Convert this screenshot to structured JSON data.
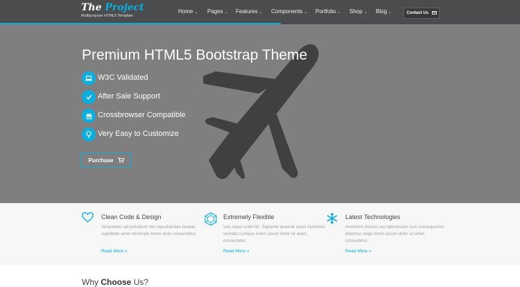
{
  "brand": {
    "title_part1": "The",
    "title_part2": "Project",
    "tagline": "Multipurpose HTML5 Template"
  },
  "nav": {
    "items": [
      {
        "label": "Home"
      },
      {
        "label": "Pages"
      },
      {
        "label": "Features"
      },
      {
        "label": "Components"
      },
      {
        "label": "Portfolio"
      },
      {
        "label": "Shop"
      },
      {
        "label": "Blog"
      }
    ],
    "contact_label": "Contact Us"
  },
  "hero": {
    "title": "Premium HTML5 Bootstrap Theme",
    "features": [
      {
        "label": "W3C Validated",
        "icon": "laptop-icon"
      },
      {
        "label": "After Sale Support",
        "icon": "check-icon"
      },
      {
        "label": "Crossbrowser Compatible",
        "icon": "gift-icon"
      },
      {
        "label": "Very Easy to Customize",
        "icon": "lightbulb-icon"
      }
    ],
    "purchase_label": "Purchase"
  },
  "services": [
    {
      "title": "Clean Code & Design",
      "icon": "heart-icon",
      "text": "Voluptatem ad provident non repudiandae beatae cupiditate amet reiciendis lorem dolor consectetur.",
      "link": "Read More"
    },
    {
      "title": "Extremely Flexible",
      "icon": "hexagon-icon",
      "text": "Iure sequi unde hic. Sapiente quaerat sequi inventore veritatis cumque lorem ipsum dolor sit amet, consectetur.",
      "link": "Read More"
    },
    {
      "title": "Latest Technologies",
      "icon": "snowflake-icon",
      "text": "Inventore dolores aut laboriosam cum consequuntur delectus sequi lorem ipsum dolor sit amet, consectetur.",
      "link": "Read More"
    }
  ],
  "why": {
    "prefix": "Why ",
    "bold": "Choose",
    "suffix": " Us?"
  },
  "colors": {
    "accent": "#09afdf",
    "navbar": "#4a4c4e",
    "hero_bg": "#7f7f7f",
    "plane": "#404040"
  }
}
